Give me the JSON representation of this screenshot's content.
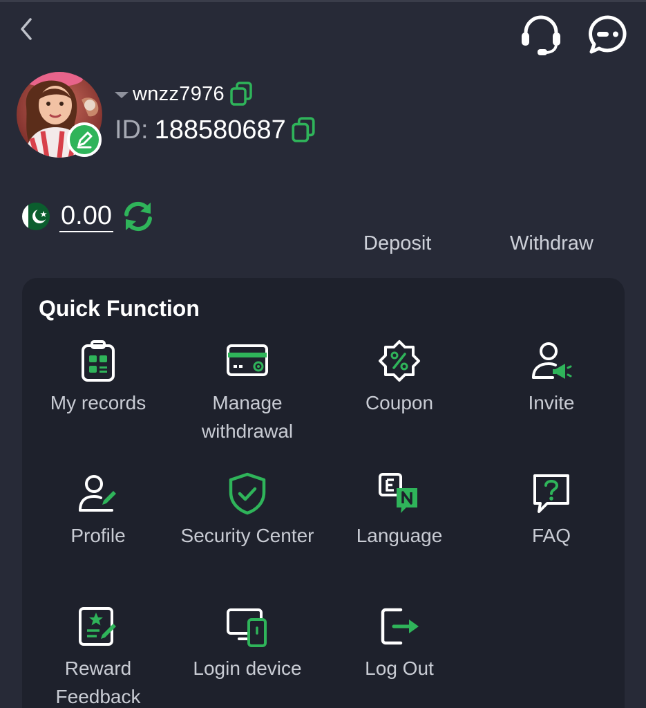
{
  "user": {
    "username": "wnzz7976",
    "id_label": "ID:",
    "id_value": "188580687"
  },
  "wallet": {
    "balance": "0.00",
    "currency_flag": "pakistan-flag-icon",
    "deposit_label": "Deposit",
    "withdraw_label": "Withdraw"
  },
  "quick_function": {
    "title": "Quick Function",
    "items": [
      {
        "label": "My records",
        "icon": "records-clipboard-icon"
      },
      {
        "label": "Manage withdrawal",
        "icon": "credit-card-icon"
      },
      {
        "label": "Coupon",
        "icon": "coupon-percent-icon"
      },
      {
        "label": "Invite",
        "icon": "invite-user-megaphone-icon"
      },
      {
        "label": "Profile",
        "icon": "profile-edit-icon"
      },
      {
        "label": "Security Center",
        "icon": "shield-check-icon"
      },
      {
        "label": "Language",
        "icon": "language-en-icon"
      },
      {
        "label": "FAQ",
        "icon": "faq-question-icon"
      },
      {
        "label": "Reward Feedback",
        "icon": "reward-feedback-icon"
      },
      {
        "label": "Login device",
        "icon": "login-device-icon"
      },
      {
        "label": "Log Out",
        "icon": "logout-icon"
      }
    ]
  },
  "colors": {
    "background": "#272a37",
    "card": "#1e212c",
    "accent_green": "#2fb45a",
    "text_muted": "#c9ccd4"
  }
}
